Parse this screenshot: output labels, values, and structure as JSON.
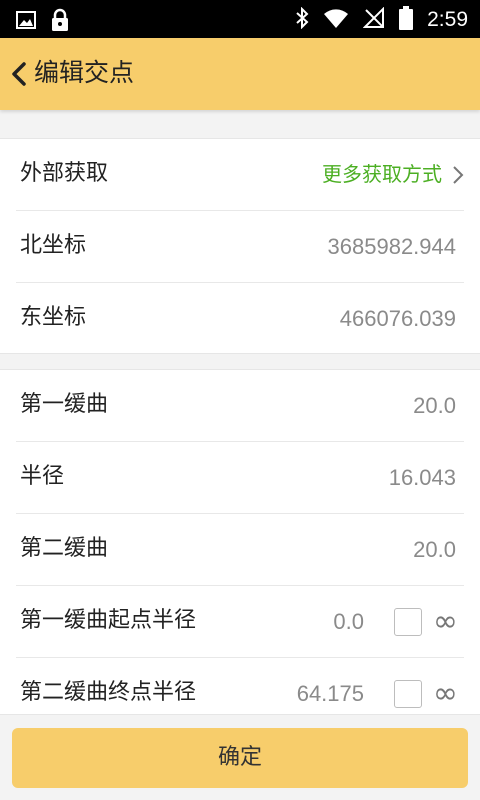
{
  "status_bar": {
    "time": "2:59",
    "left_icons": [
      "image-icon",
      "lock-icon"
    ],
    "right_icons": [
      "bluetooth-icon",
      "wifi-icon",
      "no-signal-icon",
      "battery-icon"
    ]
  },
  "header": {
    "title": "编辑交点",
    "back_icon": "chevron-left-icon"
  },
  "section1": {
    "external": {
      "label": "外部获取",
      "link": "更多获取方式"
    },
    "north": {
      "label": "北坐标",
      "value": "3685982.944"
    },
    "east": {
      "label": "东坐标",
      "value": "466076.039"
    }
  },
  "section2": {
    "first_curve": {
      "label": "第一缓曲",
      "value": "20.0"
    },
    "radius": {
      "label": "半径",
      "value": "16.043"
    },
    "second_curve": {
      "label": "第二缓曲",
      "value": "20.0"
    },
    "first_curve_start_radius": {
      "label": "第一缓曲起点半径",
      "value": "0.0",
      "infinity": "∞"
    },
    "second_curve_end_radius": {
      "label": "第二缓曲终点半径",
      "value": "64.175",
      "infinity": "∞"
    }
  },
  "footer": {
    "confirm_label": "确定"
  },
  "colors": {
    "accent": "#f7cd6b",
    "link_green": "#4caf23",
    "value_gray": "#8a8a8a"
  }
}
